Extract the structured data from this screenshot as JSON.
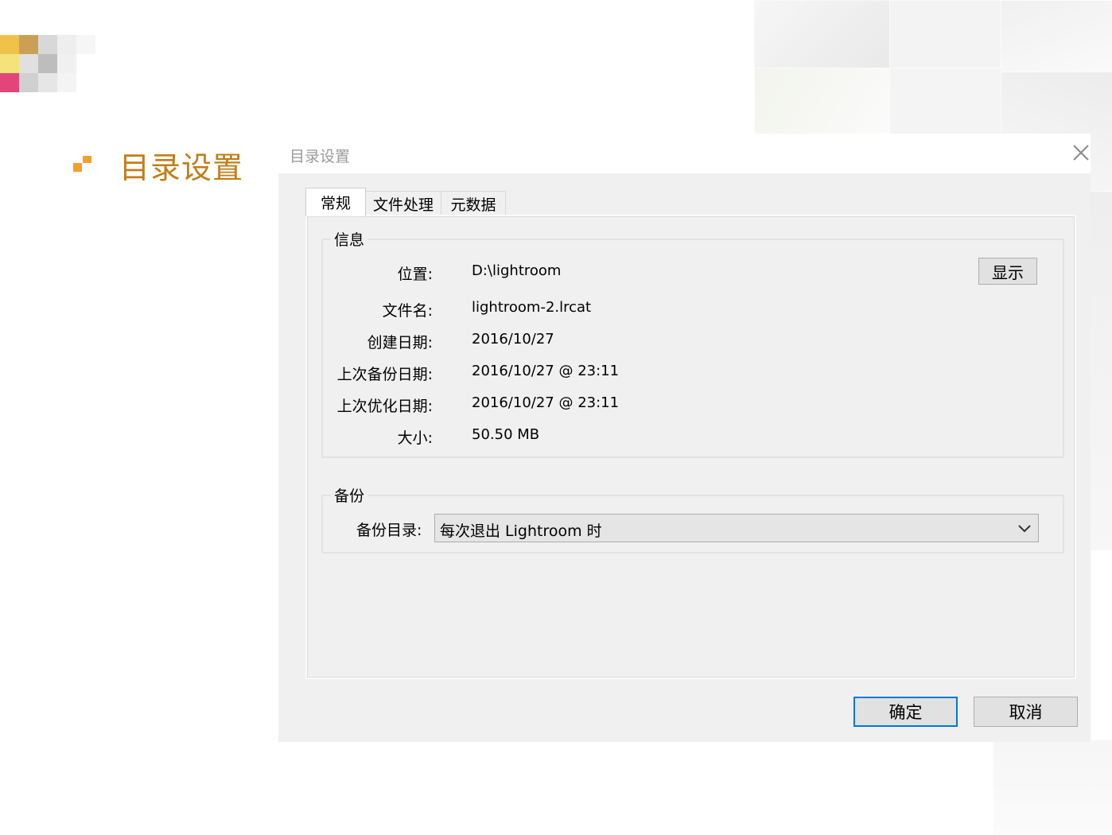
{
  "slide": {
    "title": "目录设置"
  },
  "dialog": {
    "title": "目录设置",
    "tabs": [
      {
        "label": "常规",
        "active": true
      },
      {
        "label": "文件处理",
        "active": false
      },
      {
        "label": "元数据",
        "active": false
      }
    ],
    "info": {
      "group_label": "信息",
      "show_button": "显示",
      "rows": [
        {
          "label": "位置:",
          "value": "D:\\lightroom"
        },
        {
          "label": "文件名:",
          "value": "lightroom-2.lrcat"
        },
        {
          "label": "创建日期:",
          "value": "2016/10/27"
        },
        {
          "label": "上次备份日期:",
          "value": "2016/10/27 @ 23:11"
        },
        {
          "label": "上次优化日期:",
          "value": "2016/10/27 @ 23:11"
        },
        {
          "label": "大小:",
          "value": "50.50 MB"
        }
      ]
    },
    "backup": {
      "group_label": "备份",
      "field_label": "备份目录:",
      "selected": "每次退出 Lightroom 时"
    },
    "buttons": {
      "ok": "确定",
      "cancel": "取消"
    }
  },
  "colors": {
    "accent": "#f2a12c",
    "title_gold": "#c17e17",
    "primary_border": "#0078d7"
  }
}
